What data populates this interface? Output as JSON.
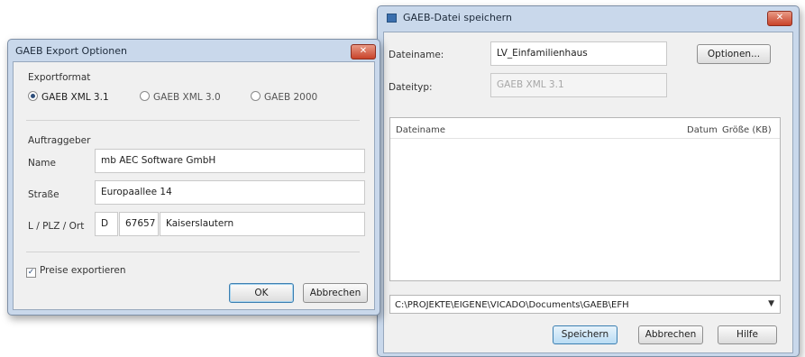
{
  "save_dialog": {
    "title": "GAEB-Datei speichern",
    "dateiname_label": "Dateiname:",
    "dateiname_value": "LV_Einfamilienhaus",
    "optionen_button": "Optionen...",
    "dateityp_label": "Dateityp:",
    "dateityp_value": "GAEB XML 3.1",
    "columns": [
      "Dateiname",
      "Datum",
      "Größe (KB)"
    ],
    "path": "C:\\PROJEKTE\\EIGENE\\VICADO\\Documents\\GAEB\\EFH",
    "buttons": {
      "save": "Speichern",
      "cancel": "Abbrechen",
      "help": "Hilfe"
    },
    "close_glyph": "✕",
    "combo_arrow": "▼"
  },
  "export_dialog": {
    "title": "GAEB Export Optionen",
    "format_heading": "Exportformat",
    "formats": [
      {
        "label": "GAEB XML 3.1",
        "selected": true
      },
      {
        "label": "GAEB XML 3.0",
        "selected": false
      },
      {
        "label": "GAEB 2000",
        "selected": false
      }
    ],
    "client_heading": "Auftraggeber",
    "name_label": "Name",
    "name_value": "mb AEC Software GmbH",
    "street_label": "Straße",
    "street_value": "Europaallee 14",
    "location_label": "L / PLZ / Ort",
    "country_value": "D",
    "zip_value": "67657",
    "city_value": "Kaiserslautern",
    "prices_checkbox": {
      "label": "Preise exportieren",
      "checked": true,
      "mark": "✓"
    },
    "buttons": {
      "ok": "OK",
      "cancel": "Abbrechen"
    },
    "close_glyph": "✕"
  },
  "colors": {
    "title_bar": "#c9d8eb",
    "close_button": "#c9432a",
    "accent_border": "#3c7fb1"
  }
}
